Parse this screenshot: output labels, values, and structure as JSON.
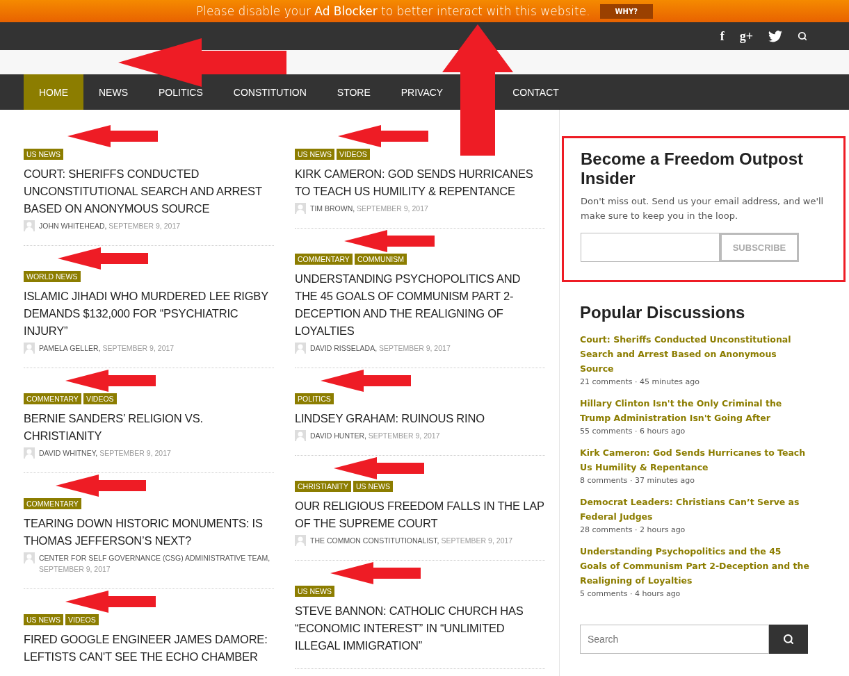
{
  "ad_bar": {
    "message": "Please disable your **Ad Blocker** to better interact with this website.",
    "button": "WHY?"
  },
  "top_bar": {
    "facebook": "f",
    "google_plus": "g+"
  },
  "nav": [
    {
      "label": "HOME",
      "selected": true
    },
    {
      "label": "NEWS",
      "selected": false
    },
    {
      "label": "POLITICS",
      "selected": false
    },
    {
      "label": "CONSTITUTION",
      "selected": false
    },
    {
      "label": "STORE",
      "selected": false
    },
    {
      "label": "PRIVACY",
      "selected": false
    },
    {
      "label": "CONTACT",
      "selected": false
    }
  ],
  "articles": [
    [
      {
        "tags": [
          "US NEWS"
        ],
        "title": "COURT: SHERIFFS CONDUCTED UNCONSTITUTIONAL SEARCH AND ARREST BASED ON ANONYMOUS SOURCE",
        "author": "JOHN WHITEHEAD,",
        "date": "SEPTEMBER 9, 2017"
      },
      {
        "tags": [
          "WORLD NEWS"
        ],
        "title": "ISLAMIC JIHADI WHO MURDERED LEE RIGBY DEMANDS $132,000 FOR “PSYCHIATRIC INJURY”",
        "author": "PAMELA GELLER,",
        "date": "SEPTEMBER 9, 2017"
      },
      {
        "tags": [
          "COMMENTARY",
          "VIDEOS"
        ],
        "title": "BERNIE SANDERS’ RELIGION VS. CHRISTIANITY",
        "author": "DAVID WHITNEY,",
        "date": "SEPTEMBER 9, 2017"
      },
      {
        "tags": [
          "COMMENTARY"
        ],
        "title": "TEARING DOWN HISTORIC MONUMENTS: IS THOMAS JEFFERSON’S NEXT?",
        "author": "CENTER FOR SELF GOVERNANCE (CSG) ADMINISTRATIVE TEAM,",
        "date": "SEPTEMBER 9, 2017"
      },
      {
        "tags": [
          "US NEWS",
          "VIDEOS"
        ],
        "title": "FIRED GOOGLE ENGINEER JAMES DAMORE: LEFTISTS CAN'T SEE THE ECHO CHAMBER"
      }
    ],
    [
      {
        "tags": [
          "US NEWS",
          "VIDEOS"
        ],
        "title": "KIRK CAMERON: GOD SENDS HURRICANES TO TEACH US HUMILITY & REPENTANCE",
        "author": "TIM BROWN,",
        "date": "SEPTEMBER 9, 2017"
      },
      {
        "tags": [
          "COMMENTARY",
          "COMMUNISM"
        ],
        "title": "UNDERSTANDING PSYCHOPOLITICS AND THE 45 GOALS OF COMMUNISM PART 2-DECEPTION AND THE REALIGNING OF LOYALTIES",
        "author": "DAVID RISSELADA,",
        "date": "SEPTEMBER 9, 2017"
      },
      {
        "tags": [
          "POLITICS"
        ],
        "title": "LINDSEY GRAHAM: RUINOUS RINO",
        "author": "DAVID HUNTER,",
        "date": "SEPTEMBER 9, 2017"
      },
      {
        "tags": [
          "CHRISTIANITY",
          "US NEWS"
        ],
        "title": "OUR RELIGIOUS FREEDOM FALLS IN THE LAP OF THE SUPREME COURT",
        "author": "THE COMMON CONSTITUTIONALIST,",
        "date": "SEPTEMBER 9, 2017"
      },
      {
        "tags": [
          "US NEWS"
        ],
        "title": "STEVE BANNON: CATHOLIC CHURCH HAS “ECONOMIC INTEREST” IN “UNLIMITED ILLEGAL IMMIGRATION”"
      }
    ]
  ],
  "newsletter": {
    "title": "Become a Freedom Outpost Insider",
    "text": "Don't miss out. Send us your email address, and we'll make sure to keep you in the loop.",
    "button": "SUBSCRIBE"
  },
  "popular": {
    "title": "Popular Discussions",
    "items": [
      {
        "title": "Court: Sheriffs Conducted Unconstitutional Search and Arrest Based on Anonymous Source",
        "meta": "21 comments · 45 minutes ago"
      },
      {
        "title": "Hillary Clinton Isn't the Only Criminal the Trump Administration Isn't Going After",
        "meta": "55 comments · 6 hours ago"
      },
      {
        "title": "Kirk Cameron: God Sends Hurricanes to Teach Us Humility & Repentance",
        "meta": "8 comments · 37 minutes ago"
      },
      {
        "title": "Democrat Leaders: Christians Can’t Serve as Federal Judges",
        "meta": "28 comments · 2 hours ago"
      },
      {
        "title": "Understanding Psychopolitics and the 45 Goals of Communism Part 2-Deception and the Realigning of Loyalties",
        "meta": "5 comments · 4 hours ago"
      }
    ]
  },
  "search": {
    "placeholder": "Search"
  }
}
